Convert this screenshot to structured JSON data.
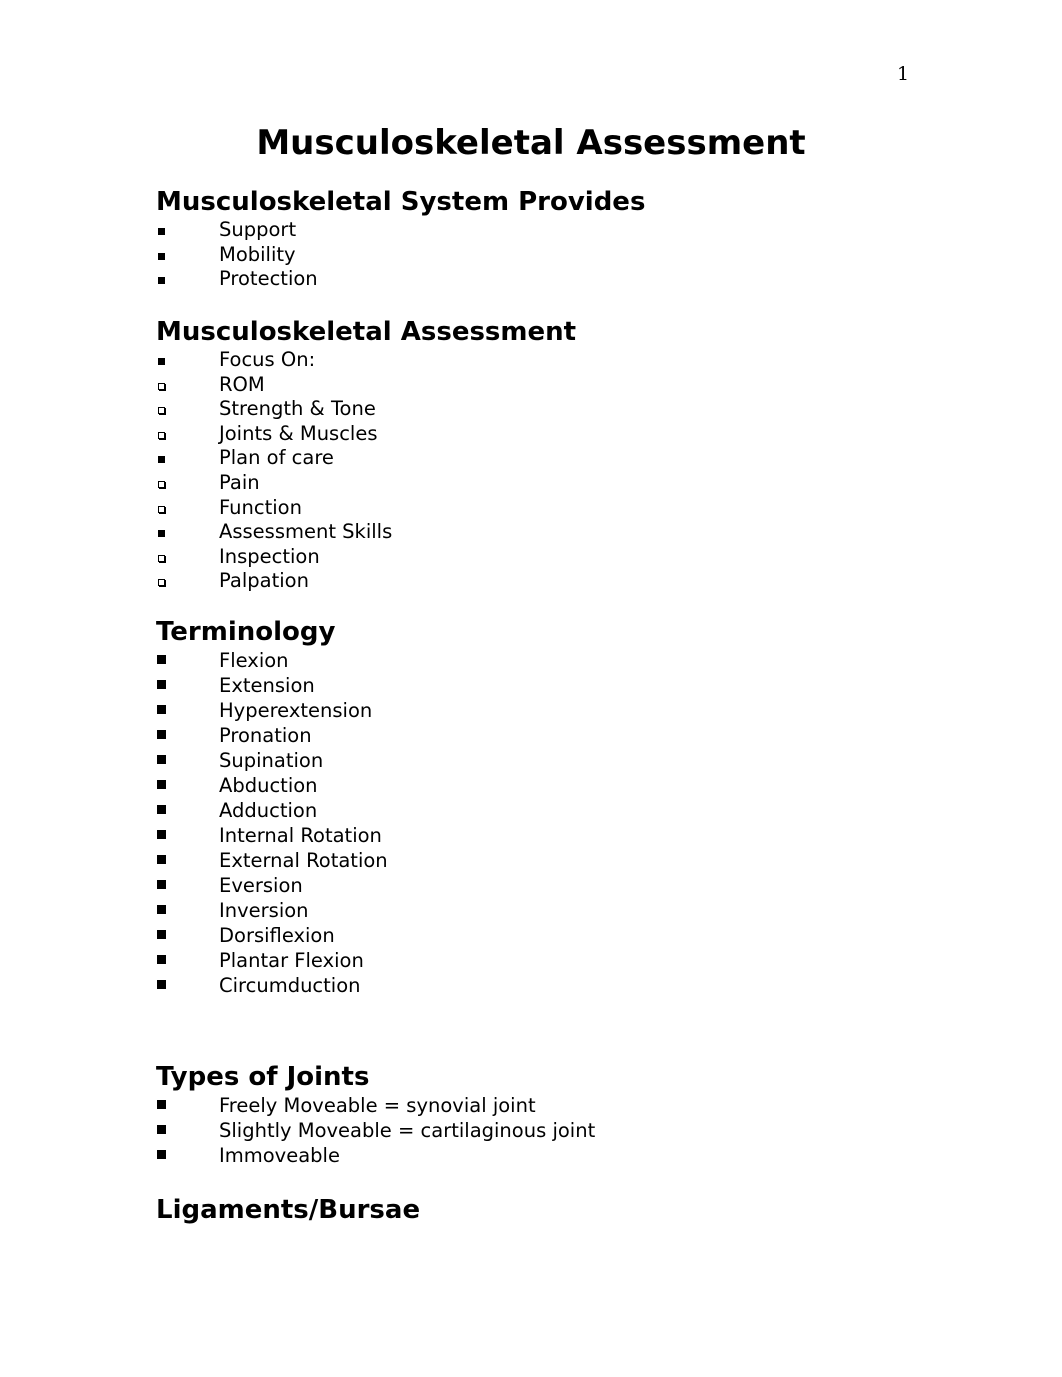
{
  "page_number": "1",
  "title": "Musculoskeletal Assessment",
  "sections": [
    {
      "heading": "Musculoskeletal System Provides",
      "items": [
        {
          "text": "Support",
          "bullet": "filled-square"
        },
        {
          "text": "Mobility",
          "bullet": "filled-square"
        },
        {
          "text": "Protection",
          "bullet": "filled-square"
        }
      ]
    },
    {
      "heading": "Musculoskeletal Assessment",
      "items": [
        {
          "text": "Focus On:",
          "bullet": "filled-square"
        },
        {
          "text": "ROM",
          "bullet": "hollow-square"
        },
        {
          "text": "Strength & Tone",
          "bullet": "hollow-square"
        },
        {
          "text": "Joints & Muscles",
          "bullet": "hollow-square"
        },
        {
          "text": "Plan of care",
          "bullet": "filled-square"
        },
        {
          "text": "Pain",
          "bullet": "hollow-square"
        },
        {
          "text": "Function",
          "bullet": "hollow-square"
        },
        {
          "text": "Assessment Skills",
          "bullet": "filled-square"
        },
        {
          "text": "Inspection",
          "bullet": "hollow-square"
        },
        {
          "text": "Palpation",
          "bullet": "hollow-square"
        }
      ]
    },
    {
      "heading": "Terminology",
      "items": [
        {
          "text": "Flexion",
          "bullet": "filled-square"
        },
        {
          "text": "Extension",
          "bullet": "filled-square"
        },
        {
          "text": "Hyperextension",
          "bullet": "filled-square"
        },
        {
          "text": "Pronation",
          "bullet": "filled-square"
        },
        {
          "text": "Supination",
          "bullet": "filled-square"
        },
        {
          "text": "Abduction",
          "bullet": "filled-square"
        },
        {
          "text": "Adduction",
          "bullet": "filled-square"
        },
        {
          "text": "Internal Rotation",
          "bullet": "filled-square"
        },
        {
          "text": "External Rotation",
          "bullet": "filled-square"
        },
        {
          "text": "Eversion",
          "bullet": "filled-square"
        },
        {
          "text": "Inversion",
          "bullet": "filled-square"
        },
        {
          "text": "Dorsiflexion",
          "bullet": "filled-square"
        },
        {
          "text": "Plantar Flexion",
          "bullet": "filled-square"
        },
        {
          "text": "Circumduction",
          "bullet": "filled-square"
        }
      ]
    },
    {
      "heading": "Types of Joints",
      "items": [
        {
          "text": "Freely Moveable = synovial joint",
          "bullet": "filled-square"
        },
        {
          "text": "Slightly Moveable = cartilaginous joint",
          "bullet": "filled-square"
        },
        {
          "text": "Immoveable",
          "bullet": "filled-square"
        }
      ]
    },
    {
      "heading": "Ligaments/Bursae",
      "items": []
    }
  ]
}
